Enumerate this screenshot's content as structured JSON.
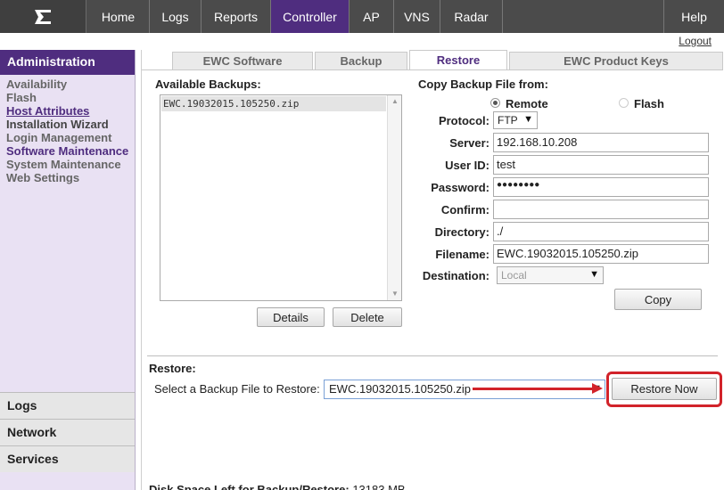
{
  "nav": {
    "items": [
      {
        "label": "Home"
      },
      {
        "label": "Logs"
      },
      {
        "label": "Reports"
      },
      {
        "label": "Controller"
      },
      {
        "label": "AP"
      },
      {
        "label": "VNS"
      },
      {
        "label": "Radar"
      },
      {
        "label": "Help"
      }
    ],
    "active": "Controller",
    "logout": "Logout"
  },
  "sidebar": {
    "header": "Administration",
    "items": [
      {
        "label": "Availability"
      },
      {
        "label": "Flash"
      },
      {
        "label": "Host Attributes"
      },
      {
        "label": "Installation Wizard"
      },
      {
        "label": "Login Management"
      },
      {
        "label": "Software Maintenance"
      },
      {
        "label": "System Maintenance"
      },
      {
        "label": "Web Settings"
      }
    ],
    "sections": [
      {
        "label": "Logs"
      },
      {
        "label": "Network"
      },
      {
        "label": "Services"
      }
    ]
  },
  "tabs": [
    {
      "label": "EWC Software"
    },
    {
      "label": "Backup"
    },
    {
      "label": "Restore"
    },
    {
      "label": "EWC Product Keys"
    }
  ],
  "active_tab": "Restore",
  "backups": {
    "title": "Available Backups:",
    "items": [
      "EWC.19032015.105250.zip"
    ],
    "details_button": "Details",
    "delete_button": "Delete"
  },
  "copy": {
    "title": "Copy Backup File from:",
    "remote_label": "Remote",
    "flash_label": "Flash",
    "selected": "Remote",
    "protocol_label": "Protocol:",
    "protocol_value": "FTP",
    "server_label": "Server:",
    "server_value": "192.168.10.208",
    "userid_label": "User ID:",
    "userid_value": "test",
    "password_label": "Password:",
    "password_value": "●●●●●●●●",
    "confirm_label": "Confirm:",
    "confirm_value": "",
    "directory_label": "Directory:",
    "directory_value": "./",
    "filename_label": "Filename:",
    "filename_value": "EWC.19032015.105250.zip",
    "destination_label": "Destination:",
    "destination_value": "Local",
    "copy_button": "Copy"
  },
  "restore": {
    "title": "Restore:",
    "select_label": "Select a Backup File to Restore:",
    "select_value": "EWC.19032015.105250.zip",
    "restore_button": "Restore Now",
    "highlight_color": "#d2232a"
  },
  "disk": {
    "label": "Disk Space Left for Backup/Restore:",
    "value": "13183 MB"
  },
  "colors": {
    "brand_purple": "#4f2d7f",
    "nav_bg": "#4b4b4b"
  }
}
